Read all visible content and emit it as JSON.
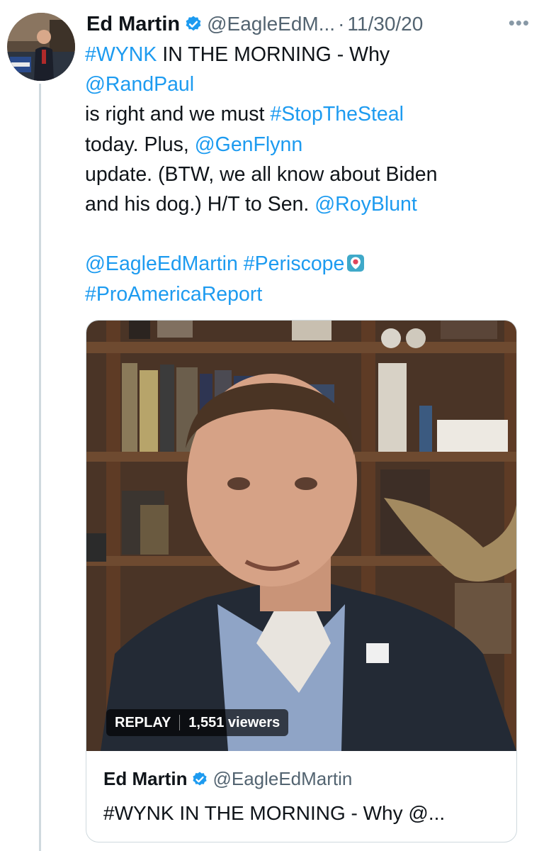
{
  "tweet": {
    "author_name": "Ed Martin",
    "author_handle": "@EagleEdM...",
    "separator": "·",
    "date": "11/30/20",
    "more_icon": "more-icon",
    "verified_icon": "verified-badge-icon",
    "avatar": "author-avatar",
    "lines": [
      [
        {
          "t": "#WYNK",
          "link": true
        },
        {
          "t": " IN THE MORNING - Why",
          "link": false
        }
      ],
      [
        {
          "t": "@RandPaul",
          "link": true
        }
      ],
      [
        {
          "t": "  is right and we must ",
          "link": false
        },
        {
          "t": "#StopTheSteal",
          "link": true
        }
      ],
      [
        {
          "t": "today. Plus, ",
          "link": false
        },
        {
          "t": "@GenFlynn",
          "link": true
        }
      ],
      [
        {
          "t": " update. (BTW, we all know about Biden",
          "link": false
        }
      ],
      [
        {
          "t": "and his dog.) H/T to Sen. ",
          "link": false
        },
        {
          "t": "@RoyBlunt",
          "link": true
        }
      ],
      [],
      [
        {
          "t": "@EagleEdMartin",
          "link": true
        },
        {
          "t": "  ",
          "link": false
        },
        {
          "t": "#Periscope",
          "link": true
        },
        {
          "icon": "periscope-icon"
        }
      ],
      [
        {
          "t": " #ProAmericaReport",
          "link": true
        }
      ]
    ]
  },
  "media_card": {
    "status_label": "REPLAY",
    "viewers_label": "1,551 viewers",
    "author_name": "Ed Martin",
    "author_handle": "@EagleEdMartin",
    "text": "#WYNK IN THE MORNING - Why @..."
  },
  "colors": {
    "link": "#1d9bf0",
    "text": "#0f1419",
    "secondary": "#536471",
    "border": "#cfd9de"
  }
}
